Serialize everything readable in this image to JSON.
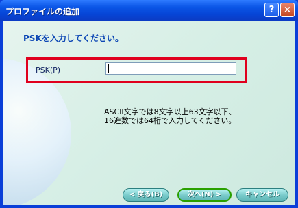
{
  "window": {
    "title": "プロファイルの追加",
    "help_label": "?",
    "close_label": "×"
  },
  "content": {
    "heading": "PSKを入力してください。",
    "psk_label": "PSK(P)",
    "psk_value": "",
    "note_line1": "ASCII文字では8文字以上63文字以下、",
    "note_line2": "16進数では64桁で入力してください。"
  },
  "buttons": {
    "back_label": "< 戻る(B)",
    "next_label": "次へ(N) >",
    "cancel_label": "キャンセル"
  }
}
